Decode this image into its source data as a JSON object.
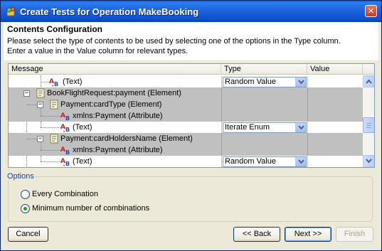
{
  "window": {
    "title": "Create Tests for Operation MakeBooking",
    "close_glyph": "✕"
  },
  "header": {
    "title": "Contents Configuration",
    "desc_line1": "Please select the type of contents to be used by selecting one of the options in the Type column.",
    "desc_line2": "Enter a value in the Value column for relevant types."
  },
  "table": {
    "columns": [
      "Message",
      "Type",
      "Value"
    ],
    "rows": [
      {
        "label": "(Text)",
        "kind": "text",
        "type": "Random Value",
        "value": ""
      },
      {
        "label": "BookFlightRequest:payment (Element)",
        "kind": "element",
        "type": "",
        "value": ""
      },
      {
        "label": "Payment:cardType (Element)",
        "kind": "element",
        "type": "",
        "value": ""
      },
      {
        "label": "xmlns:Payment (Attribute)",
        "kind": "attribute",
        "type": "",
        "value": ""
      },
      {
        "label": "(Text)",
        "kind": "text",
        "type": "Iterate Enum",
        "value": ""
      },
      {
        "label": "Payment:cardHoldersName (Element)",
        "kind": "element",
        "type": "",
        "value": ""
      },
      {
        "label": "xmlns:Payment (Attribute)",
        "kind": "attribute",
        "type": "",
        "value": ""
      },
      {
        "label": "(Text)",
        "kind": "text",
        "type": "Random Value",
        "value": ""
      }
    ]
  },
  "options": {
    "legend": "Options",
    "every_combination": "Every Combination",
    "minimum_combinations": "Minimum number of combinations",
    "selected": "minimum_combinations"
  },
  "buttons": {
    "cancel": "Cancel",
    "back": "<< Back",
    "next": "Next >>",
    "finish": "Finish"
  },
  "colors": {
    "title_bar": "#0a5cdc",
    "window_bg": "#ece9d8",
    "gray_row": "#c0c0c0",
    "options_legend": "#0046d5"
  }
}
